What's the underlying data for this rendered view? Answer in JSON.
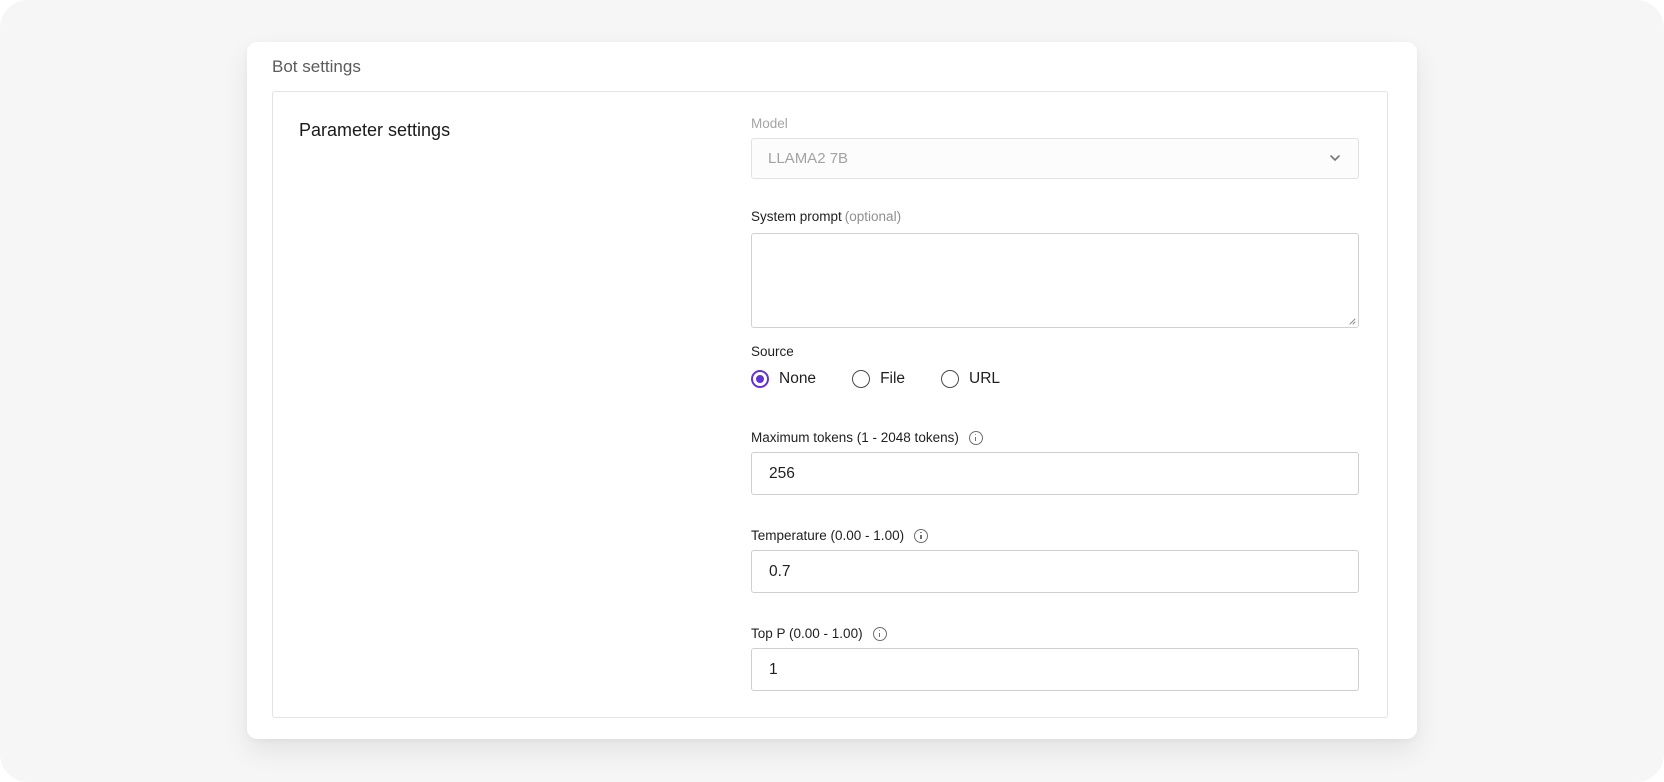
{
  "card": {
    "title": "Bot settings"
  },
  "panel": {
    "heading": "Parameter settings"
  },
  "model": {
    "label": "Model",
    "value": "LLAMA2 7B",
    "icon": "chevron-down-icon"
  },
  "system_prompt": {
    "label": "System prompt",
    "optional": "(optional)",
    "value": ""
  },
  "source": {
    "label": "Source",
    "options": [
      "None",
      "File",
      "URL"
    ],
    "selected": "None",
    "accent": "#6232d6"
  },
  "max_tokens": {
    "label": "Maximum tokens (1 - 2048 tokens)",
    "value": "256",
    "icon": "info-icon"
  },
  "temperature": {
    "label": "Temperature (0.00 - 1.00)",
    "value": "0.7",
    "icon": "info-icon"
  },
  "top_p": {
    "label": "Top P (0.00 - 1.00)",
    "value": "1",
    "icon": "info-icon"
  }
}
